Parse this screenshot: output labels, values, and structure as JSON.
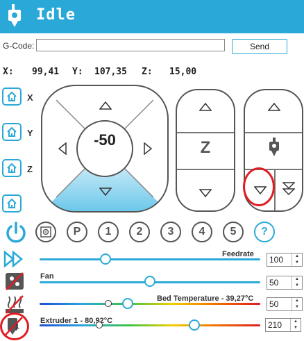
{
  "header": {
    "title": "Idle",
    "color": "#2aa9d8"
  },
  "gcode": {
    "label": "G-Code:",
    "value": "",
    "send_label": "Send"
  },
  "coords": {
    "x_label": "X:",
    "x_value": "99,41",
    "y_label": "Y:",
    "y_value": "107,35",
    "z_label": "Z:",
    "z_value": "15,00"
  },
  "home": {
    "x": "X",
    "y": "Y",
    "z": "Z"
  },
  "jog": {
    "step": "-50",
    "z_label": "Z"
  },
  "toolbar": {
    "positions": [
      "P",
      "1",
      "2",
      "3",
      "4",
      "5"
    ],
    "help": "?"
  },
  "sliders": {
    "feedrate": {
      "label": "Feedrate",
      "value": "100",
      "level": 0.3
    },
    "fan": {
      "label": "Fan",
      "value": "50",
      "level": 0.5
    },
    "bed": {
      "label": "Bed Temperature - 39,27°C",
      "value": "50",
      "level": 0.4,
      "actual_level": 0.31
    },
    "extruder": {
      "label": "Extruder 1 - 80,92°C",
      "value": "210",
      "level": 0.7,
      "actual_level": 0.27,
      "badge": "1"
    }
  },
  "colors": {
    "accent": "#2aa9d8",
    "highlight": "#e01c24",
    "pad_fill": "#86d3ee"
  }
}
